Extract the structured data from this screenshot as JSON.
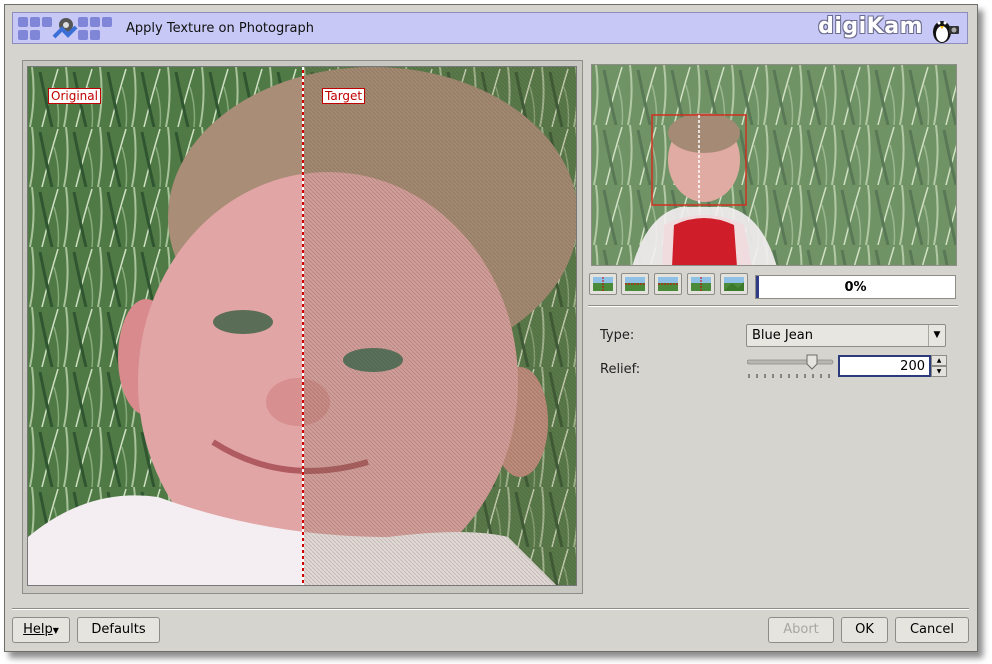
{
  "window": {
    "title": "Apply Texture on Photograph",
    "brand": "digiKam"
  },
  "preview": {
    "original_label": "Original",
    "target_label": "Target"
  },
  "progress": {
    "value": 0,
    "text": "0%"
  },
  "settings": {
    "type_label": "Type:",
    "type_value": "Blue Jean",
    "relief_label": "Relief:",
    "relief_value": "200"
  },
  "buttons": {
    "help": "Help",
    "defaults": "Defaults",
    "abort": "Abort",
    "ok": "OK",
    "cancel": "Cancel"
  },
  "colors": {
    "header_bg": "#c7c8f5",
    "window_bg": "#d6d4cf",
    "label_red": "#c00000",
    "progress_fill": "#2e3d86"
  }
}
